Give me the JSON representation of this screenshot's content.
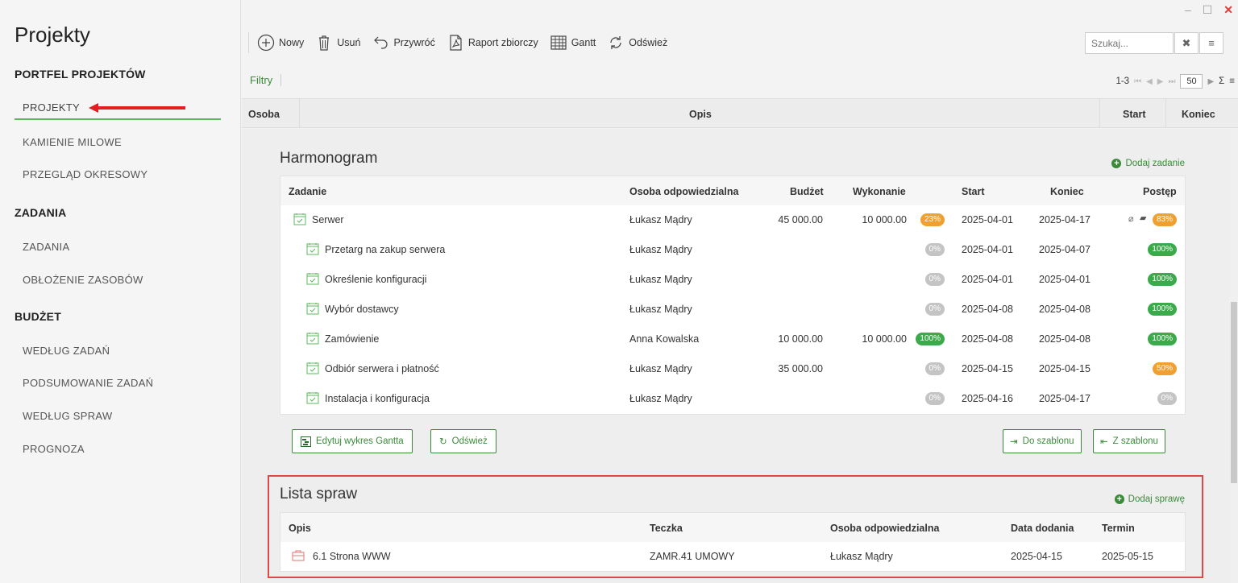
{
  "window": {
    "minimize": "–",
    "maximize": "☐",
    "close": "✕"
  },
  "sidebar": {
    "title": "Projekty",
    "sections": [
      {
        "label": "PORTFEL PROJEKTÓW",
        "items": [
          "PROJEKTY",
          "KAMIENIE MILOWE",
          "PRZEGLĄD OKRESOWY"
        ]
      },
      {
        "label": "ZADANIA",
        "items": [
          "ZADANIA",
          "OBŁOŻENIE ZASOBÓW"
        ]
      },
      {
        "label": "BUDŻET",
        "items": [
          "WEDŁUG ZADAŃ",
          "PODSUMOWANIE ZADAŃ",
          "WEDŁUG SPRAW",
          "PROGNOZA"
        ]
      }
    ],
    "active_item": "PROJEKTY"
  },
  "toolbar": {
    "new": "Nowy",
    "delete": "Usuń",
    "restore": "Przywróć",
    "report": "Raport zbiorczy",
    "gantt": "Gantt",
    "refresh": "Odśwież"
  },
  "search": {
    "placeholder": "Szukaj...",
    "clear": "✖",
    "menu": "≡"
  },
  "filters": "Filtry",
  "pager": {
    "range": "1-3",
    "page_size": "50",
    "sum": "Σ",
    "menu": "≡"
  },
  "grid": {
    "columns": [
      "Osoba",
      "Opis",
      "Start",
      "Koniec"
    ]
  },
  "harmonogram": {
    "title": "Harmonogram",
    "add": "Dodaj zadanie",
    "columns": [
      "Zadanie",
      "Osoba odpowiedzialna",
      "Budżet",
      "Wykonanie",
      "Start",
      "Koniec",
      "Postęp"
    ],
    "rows": [
      {
        "task": "Serwer",
        "person": "Łukasz Mądry",
        "budget": "45 000.00",
        "done": "10 000.00",
        "exec_pct": "23%",
        "start": "2025-04-01",
        "end": "2025-04-17",
        "progress": "83%"
      },
      {
        "task": "Przetarg na zakup serwera",
        "person": "Łukasz Mądry",
        "budget": "",
        "done": "",
        "exec_pct": "0%",
        "start": "2025-04-01",
        "end": "2025-04-07",
        "progress": "100%"
      },
      {
        "task": "Określenie konfiguracji",
        "person": "Łukasz Mądry",
        "budget": "",
        "done": "",
        "exec_pct": "0%",
        "start": "2025-04-01",
        "end": "2025-04-01",
        "progress": "100%"
      },
      {
        "task": "Wybór dostawcy",
        "person": "Łukasz Mądry",
        "budget": "",
        "done": "",
        "exec_pct": "0%",
        "start": "2025-04-08",
        "end": "2025-04-08",
        "progress": "100%"
      },
      {
        "task": "Zamówienie",
        "person": "Anna Kowalska",
        "budget": "10 000.00",
        "done": "10 000.00",
        "exec_pct": "100%",
        "start": "2025-04-08",
        "end": "2025-04-08",
        "progress": "100%"
      },
      {
        "task": "Odbiór serwera i płatność",
        "person": "Łukasz Mądry",
        "budget": "35 000.00",
        "done": "",
        "exec_pct": "0%",
        "start": "2025-04-15",
        "end": "2025-04-15",
        "progress": "50%"
      },
      {
        "task": "Instalacja i konfiguracja",
        "person": "Łukasz Mądry",
        "budget": "",
        "done": "",
        "exec_pct": "0%",
        "start": "2025-04-16",
        "end": "2025-04-17",
        "progress": "0%"
      }
    ],
    "edit_gantt": "Edytuj wykres Gantta",
    "refresh": "Odśwież",
    "to_template": "Do szablonu",
    "from_template": "Z szablonu"
  },
  "cases": {
    "title": "Lista spraw",
    "add": "Dodaj sprawę",
    "columns": [
      "Opis",
      "Teczka",
      "Osoba odpowiedzialna",
      "Data dodania",
      "Termin"
    ],
    "rows": [
      {
        "desc": "6.1 Strona WWW",
        "folder": "ZAMR.41 UMOWY",
        "person": "Łukasz Mądry",
        "added": "2025-04-15",
        "due": "2025-05-15"
      }
    ]
  },
  "colors": {
    "accent_green": "#3a8a3a",
    "highlight_red": "#e04848",
    "badge_orange": "#f0a030",
    "badge_green": "#3aaa4a",
    "badge_grey": "#c4c4c4"
  }
}
